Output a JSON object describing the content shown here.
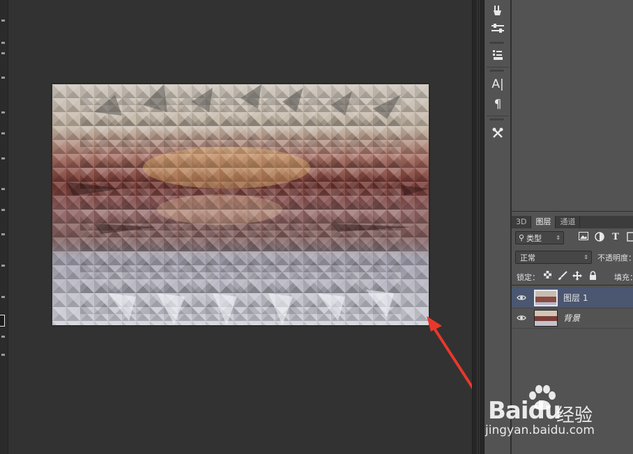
{
  "app": {
    "accent_color": "#4b5670",
    "background_color": "#323232",
    "panel_color": "#535353"
  },
  "toolbar_icons": [
    "tools-icon",
    "brush-settings-icon",
    "clone-source-icon",
    "character-icon",
    "paragraph-icon",
    "tool-presets-icon"
  ],
  "dock": {
    "character_glyph": "A|",
    "paragraph_glyph": "¶"
  },
  "panel": {
    "tabs": [
      {
        "label": "3D",
        "active": false
      },
      {
        "label": "图层",
        "active": true
      },
      {
        "label": "通道",
        "active": false
      }
    ],
    "filter_kind": "类型",
    "filter_icons": [
      "image-filter-icon",
      "adjustment-filter-icon",
      "type-filter-icon",
      "shape-filter-icon"
    ],
    "type_filter_glyph": "T",
    "blend_mode": "正常",
    "opacity_label": "不透明度：",
    "lock_label": "锁定：",
    "lock_icons": [
      "lock-transparent-icon",
      "lock-pixels-icon",
      "lock-position-icon",
      "lock-all-icon"
    ],
    "fill_label": "填充："
  },
  "layers": [
    {
      "name": "图层 1",
      "visible": true,
      "selected": true,
      "italic": false
    },
    {
      "name": "背景",
      "visible": true,
      "selected": false,
      "italic": true
    }
  ],
  "annotation": {
    "color": "#e8382b"
  },
  "watermark": {
    "logo_text": "Baidu",
    "logo_suffix": "经验",
    "url": "jingyan.baidu.com"
  }
}
